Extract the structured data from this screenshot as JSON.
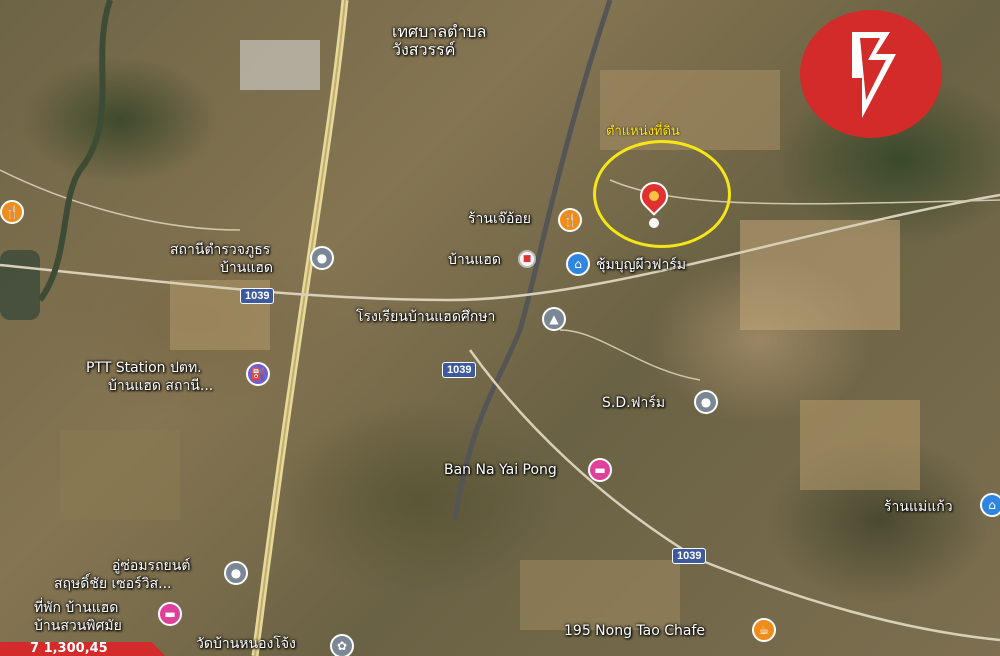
{
  "map": {
    "district_label_line1": "เทศบาลตำบล",
    "district_label_line2": "วังสวรรค์",
    "land_position_label": "ตำแหน่งที่ดิน",
    "road_number": "1039",
    "places": {
      "jeoy": "ร้านเจ๊อ้อย",
      "police_line1": "สถานีตำรวจภูธร",
      "police_line2": "บ้านแฮด",
      "banhaed": "บ้านแฮด",
      "farm": "ชุ้มบุญผีวฟาร์ม",
      "school": "โรงเรียนบ้านแฮดศึกษา",
      "ptt_line1": "PTT Station ปตท.",
      "ptt_line2": "บ้านแฮด สถานี...",
      "sd_farm": "S.D.ฟาร์ม",
      "ban_na": "Ban Na Yai Pong",
      "mae_kaew": "ร้านแม่แก้ว",
      "garage_line1": "อู่ซ่อมรถยนต์",
      "garage_line2": "สฤษดิ์ชัย เซอร์วิส...",
      "lodge_line1": "ที่พัก บ้านแฮด",
      "lodge_line2": "บ้านสวนพิศมัย",
      "temple": "วัดบ้านหนองโจ้ง",
      "cafe": "195 Nong Tao Chafe"
    },
    "badge_partial": "7 1,300,45"
  },
  "colors": {
    "brand": "#d32a2a",
    "highlight_circle": "#f5e616",
    "pin": "#e03131",
    "road_badge": "#3d5a9e"
  }
}
